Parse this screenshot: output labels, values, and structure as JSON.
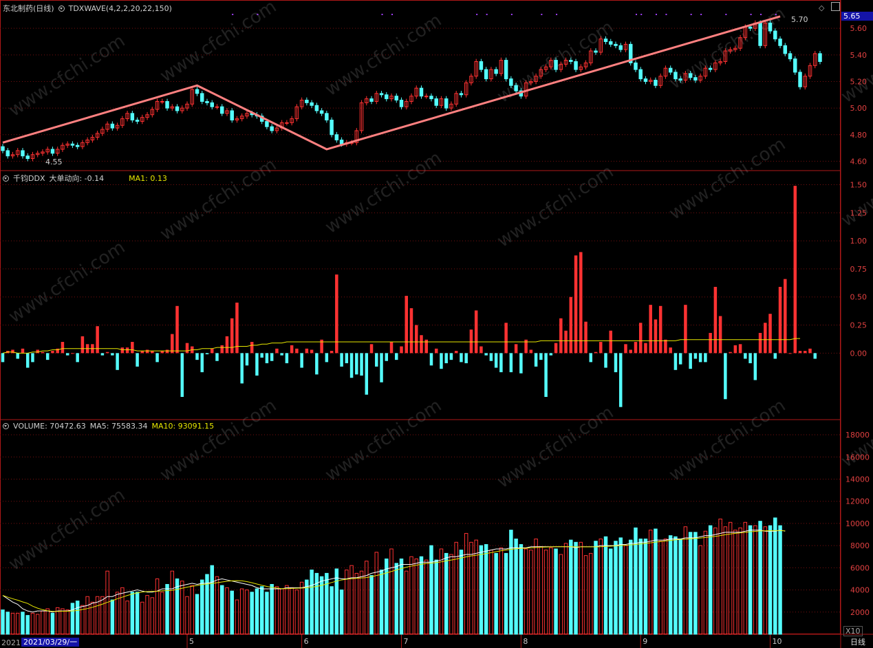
{
  "window": {
    "stock_title": "东北制药(日线)",
    "indicator_title": "TDXWAVE(4,2,2,20,22,150)",
    "price_box": "5.65",
    "period_label": "日线",
    "scale_label": "X10",
    "date_box": "2021/03/29/一",
    "year_prefix": "2021",
    "watermark": "www.cfchi.com"
  },
  "panels": {
    "price": {
      "high_label": "5.70",
      "low_label": "4.55",
      "axis_ticks": [
        "5.60",
        "5.40",
        "5.20",
        "5.00",
        "4.80",
        "4.60"
      ]
    },
    "ddx": {
      "title": "千钧DDX",
      "value_label": "大单动向: -0.14",
      "ma_label": "MA1: 0.13",
      "axis_ticks": [
        "1.50",
        "1.25",
        "1.00",
        "0.75",
        "0.50",
        "0.25",
        "0.00"
      ]
    },
    "volume": {
      "title": "VOLUME: 70472.63",
      "ma5_label": "MA5: 75583.34",
      "ma10_label": "MA10: 93091.15",
      "axis_ticks": [
        "18000",
        "16000",
        "14000",
        "12000",
        "10000",
        "8000",
        "6000",
        "4000",
        "2000"
      ]
    }
  },
  "x_axis": {
    "month_labels": [
      "5",
      "6",
      "7",
      "8",
      "9",
      "10"
    ]
  },
  "colors": {
    "up": "#ff3232",
    "down": "#54fcfc",
    "wave": "#ff8080",
    "ma_white": "#ffffff",
    "ma_yellow": "#e8e800",
    "grid": "#7a1010",
    "border": "#b01818"
  },
  "chart_data": {
    "type": "candlestick",
    "date_start": "2021/03/29",
    "price_range": [
      4.55,
      5.7
    ],
    "wave_points": [
      {
        "bar": 0,
        "price": 4.74
      },
      {
        "bar": 39,
        "price": 5.17
      },
      {
        "bar": 65,
        "price": 4.69
      },
      {
        "bar": 156,
        "price": 5.69
      }
    ],
    "price_open": [
      4.71,
      4.68,
      4.64,
      4.65,
      4.68,
      4.64,
      4.62,
      4.65,
      4.66,
      4.67,
      4.69,
      4.66,
      4.69,
      4.72,
      4.73,
      4.72,
      4.71,
      4.74,
      4.76,
      4.78,
      4.81,
      4.84,
      4.88,
      4.85,
      4.87,
      4.92,
      4.96,
      4.91,
      4.9,
      4.93,
      4.95,
      4.99,
      5.05,
      5.05,
      5.0,
      5.01,
      4.98,
      5.0,
      5.03,
      5.14,
      5.11,
      5.05,
      5.04,
      5.01,
      5.01,
      4.96,
      4.98,
      4.91,
      4.92,
      4.94,
      4.96,
      4.95,
      4.94,
      4.9,
      4.86,
      4.83,
      4.85,
      4.89,
      4.89,
      4.92,
      5.01,
      5.06,
      5.04,
      5.02,
      4.98,
      4.96,
      4.91,
      4.8,
      4.76,
      4.73,
      4.74,
      4.74,
      4.83,
      5.04,
      5.07,
      5.05,
      5.11,
      5.1,
      5.07,
      5.09,
      5.06,
      5.01,
      5.05,
      5.09,
      5.15,
      5.09,
      5.09,
      5.07,
      5.02,
      5.07,
      5.0,
      5.03,
      5.11,
      5.1,
      5.19,
      5.24,
      5.35,
      5.29,
      5.22,
      5.29,
      5.26,
      5.36,
      5.22,
      5.17,
      5.13,
      5.09,
      5.19,
      5.2,
      5.24,
      5.29,
      5.31,
      5.36,
      5.29,
      5.33,
      5.36,
      5.35,
      5.29,
      5.31,
      5.34,
      5.43,
      5.42,
      5.52,
      5.5,
      5.48,
      5.47,
      5.44,
      5.48,
      5.34,
      5.29,
      5.22,
      5.2,
      5.21,
      5.17,
      5.24,
      5.3,
      5.27,
      5.22,
      5.21,
      5.26,
      5.23,
      5.21,
      5.24,
      5.3,
      5.29,
      5.34,
      5.35,
      5.43,
      5.44,
      5.45,
      5.53,
      5.61,
      5.6,
      5.64,
      5.47,
      5.64,
      5.58,
      5.52,
      5.47,
      5.41,
      5.37,
      5.27,
      5.16,
      5.24,
      5.32,
      5.41
    ],
    "price_close": [
      4.68,
      4.64,
      4.65,
      4.68,
      4.64,
      4.62,
      4.65,
      4.66,
      4.67,
      4.69,
      4.66,
      4.69,
      4.72,
      4.73,
      4.72,
      4.71,
      4.74,
      4.76,
      4.78,
      4.81,
      4.84,
      4.88,
      4.85,
      4.87,
      4.92,
      4.96,
      4.91,
      4.9,
      4.93,
      4.95,
      4.99,
      5.05,
      5.05,
      5.0,
      5.01,
      4.98,
      5.0,
      5.03,
      5.14,
      5.11,
      5.05,
      5.04,
      5.01,
      5.01,
      4.96,
      4.98,
      4.91,
      4.92,
      4.94,
      4.96,
      4.95,
      4.94,
      4.9,
      4.86,
      4.83,
      4.85,
      4.89,
      4.89,
      4.92,
      5.01,
      5.06,
      5.04,
      5.02,
      4.98,
      4.96,
      4.91,
      4.8,
      4.76,
      4.73,
      4.74,
      4.74,
      4.83,
      5.04,
      5.07,
      5.05,
      5.11,
      5.1,
      5.07,
      5.09,
      5.06,
      5.01,
      5.05,
      5.09,
      5.15,
      5.09,
      5.09,
      5.07,
      5.02,
      5.07,
      5.0,
      5.03,
      5.11,
      5.1,
      5.19,
      5.24,
      5.35,
      5.29,
      5.22,
      5.29,
      5.26,
      5.36,
      5.22,
      5.17,
      5.13,
      5.09,
      5.19,
      5.2,
      5.24,
      5.29,
      5.31,
      5.36,
      5.29,
      5.33,
      5.36,
      5.35,
      5.29,
      5.31,
      5.34,
      5.43,
      5.42,
      5.52,
      5.5,
      5.48,
      5.47,
      5.44,
      5.48,
      5.34,
      5.29,
      5.22,
      5.2,
      5.21,
      5.17,
      5.24,
      5.3,
      5.27,
      5.22,
      5.21,
      5.26,
      5.23,
      5.21,
      5.24,
      5.3,
      5.29,
      5.34,
      5.35,
      5.43,
      5.44,
      5.45,
      5.53,
      5.61,
      5.6,
      5.64,
      5.47,
      5.64,
      5.58,
      5.52,
      5.47,
      5.41,
      5.37,
      5.27,
      5.16,
      5.24,
      5.32,
      5.41,
      5.35
    ],
    "ddx": [
      -0.08,
      0.02,
      0.03,
      -0.05,
      0.04,
      -0.13,
      -0.08,
      0.03,
      0.01,
      -0.06,
      0.02,
      0.04,
      0.1,
      -0.02,
      0.0,
      -0.08,
      0.15,
      0.08,
      0.08,
      0.24,
      -0.02,
      0.01,
      -0.02,
      -0.15,
      0.05,
      0.05,
      0.1,
      -0.12,
      0.02,
      0.03,
      0.02,
      -0.08,
      0.02,
      0.03,
      0.17,
      0.42,
      -0.39,
      0.09,
      0.06,
      -0.06,
      -0.17,
      -0.01,
      0.04,
      -0.07,
      0.07,
      0.15,
      0.31,
      0.45,
      -0.27,
      -0.11,
      0.1,
      -0.2,
      -0.04,
      -0.09,
      -0.07,
      0.04,
      -0.02,
      -0.09,
      0.07,
      0.04,
      -0.13,
      0.04,
      0.03,
      -0.19,
      0.12,
      -0.08,
      0.02,
      0.7,
      -0.12,
      -0.09,
      -0.22,
      -0.19,
      -0.2,
      -0.37,
      0.08,
      -0.12,
      -0.26,
      -0.07,
      0.1,
      -0.06,
      0.06,
      0.51,
      0.4,
      0.25,
      0.16,
      0.12,
      -0.11,
      0.04,
      -0.14,
      -0.09,
      -0.06,
      0.02,
      -0.08,
      -0.09,
      0.21,
      0.38,
      0.06,
      -0.02,
      -0.07,
      -0.13,
      -0.17,
      0.27,
      -0.17,
      0.08,
      -0.18,
      0.12,
      0.03,
      -0.12,
      -0.06,
      -0.39,
      -0.02,
      0.09,
      0.31,
      0.2,
      0.5,
      0.87,
      0.9,
      0.28,
      -0.08,
      0.01,
      0.1,
      -0.13,
      0.2,
      -0.17,
      -0.48,
      0.08,
      0.03,
      0.1,
      0.27,
      0.09,
      0.43,
      0.3,
      0.42,
      0.12,
      0.05,
      -0.15,
      -0.1,
      0.43,
      -0.14,
      -0.05,
      -0.08,
      -0.08,
      0.18,
      0.59,
      0.33,
      -0.41,
      0.01,
      0.07,
      0.08,
      -0.05,
      -0.09,
      -0.24,
      0.18,
      0.27,
      0.35,
      -0.05,
      0.59,
      0.66,
      0.0,
      1.49,
      0.02,
      0.02,
      0.04,
      -0.05
    ],
    "ddx_ma": [
      0.0,
      0.01,
      0.01,
      0.0,
      0.0,
      -0.0,
      0.01,
      0.01,
      0.02,
      0.02,
      0.03,
      0.03,
      0.04,
      0.04,
      0.04,
      0.04,
      0.04,
      0.04,
      0.04,
      0.04,
      0.04,
      0.04,
      0.04,
      0.04,
      0.03,
      0.03,
      0.03,
      0.02,
      0.02,
      0.02,
      0.02,
      0.02,
      0.02,
      0.02,
      0.02,
      0.02,
      0.02,
      0.02,
      0.03,
      0.03,
      0.04,
      0.04,
      0.04,
      0.05,
      0.05,
      0.05,
      0.05,
      0.06,
      0.06,
      0.06,
      0.07,
      0.07,
      0.08,
      0.08,
      0.09,
      0.09,
      0.09,
      0.1,
      0.1,
      0.1,
      0.1,
      0.1,
      0.1,
      0.1,
      0.1,
      0.1,
      0.1,
      0.1,
      0.1,
      0.1,
      0.1,
      0.1,
      0.1,
      0.1,
      0.1,
      0.1,
      0.1,
      0.1,
      0.1,
      0.1,
      0.1,
      0.1,
      0.1,
      0.1,
      0.1,
      0.1,
      0.1,
      0.1,
      0.1,
      0.1,
      0.1,
      0.1,
      0.1,
      0.1,
      0.1,
      0.1,
      0.1,
      0.1,
      0.1,
      0.1,
      0.1,
      0.1,
      0.1,
      0.1,
      0.1,
      0.1,
      0.1,
      0.1,
      0.11,
      0.11,
      0.11,
      0.11,
      0.11,
      0.11,
      0.11,
      0.11,
      0.11,
      0.11,
      0.11,
      0.11,
      0.11,
      0.11,
      0.11,
      0.11,
      0.11,
      0.11,
      0.11,
      0.11,
      0.11,
      0.11,
      0.11,
      0.11,
      0.11,
      0.11,
      0.11,
      0.11,
      0.12,
      0.12,
      0.12,
      0.12,
      0.12,
      0.12,
      0.12,
      0.12,
      0.12,
      0.12,
      0.12,
      0.12,
      0.12,
      0.12,
      0.12,
      0.12,
      0.12,
      0.12,
      0.12,
      0.12,
      0.12,
      0.12,
      0.12,
      0.13,
      0.13
    ],
    "volume": [
      2200,
      2000,
      1900,
      1900,
      2000,
      1700,
      1900,
      1800,
      2100,
      2300,
      1900,
      2400,
      2300,
      2200,
      2800,
      3000,
      2600,
      3400,
      2900,
      3400,
      3400,
      5700,
      3100,
      3800,
      4200,
      3000,
      3800,
      3800,
      2900,
      3500,
      3300,
      5000,
      3800,
      4500,
      5700,
      5000,
      4800,
      3400,
      4400,
      3600,
      4900,
      5400,
      6200,
      5200,
      4400,
      4200,
      3900,
      3100,
      4100,
      4000,
      3800,
      4100,
      4300,
      3800,
      4500,
      4300,
      4100,
      4400,
      4200,
      4000,
      4700,
      4900,
      5800,
      5500,
      5200,
      5500,
      4300,
      5900,
      4000,
      5800,
      6200,
      5500,
      5700,
      6600,
      5300,
      7400,
      5800,
      6800,
      7700,
      6400,
      6800,
      5700,
      7000,
      6800,
      7000,
      6700,
      8000,
      6700,
      7700,
      7300,
      7200,
      8300,
      7600,
      9100,
      8300,
      8500,
      8000,
      8100,
      7600,
      7300,
      7800,
      7300,
      9400,
      8600,
      8100,
      7700,
      7600,
      8600,
      7900,
      7600,
      7800,
      7700,
      7200,
      8200,
      8500,
      8300,
      8300,
      7100,
      7300,
      8400,
      8600,
      8800,
      7700,
      8400,
      8700,
      8000,
      8500,
      9600,
      8600,
      8600,
      9400,
      9500,
      8400,
      8600,
      8900,
      8800,
      8600,
      9700,
      9200,
      9200,
      8000,
      9300,
      9800,
      9600,
      10400,
      9700,
      10100,
      9400,
      9600,
      10100,
      9800,
      9800,
      10200,
      9700,
      9800,
      10500,
      9800
    ],
    "volume_ma5": [
      3500,
      3200,
      2900,
      2700,
      2300,
      2100,
      2000,
      2100,
      2100,
      2100,
      2000,
      2100,
      2100,
      2100,
      2200,
      2400,
      2500,
      2600,
      2800,
      2900,
      3100,
      3400,
      3400,
      3600,
      3700,
      3800,
      3900,
      4000,
      3900,
      3800,
      3800,
      3900,
      4100,
      4100,
      4100,
      4300,
      4400,
      4500,
      4600,
      4500,
      4600,
      4600,
      4700,
      4900,
      5000,
      4900,
      4800,
      4700,
      4600,
      4500,
      4400,
      4200,
      4100,
      4100,
      4100,
      4100,
      4100,
      4200,
      4200,
      4200,
      4200,
      4300,
      4400,
      4600,
      4800,
      4900,
      5000,
      5100,
      5000,
      5000,
      5100,
      5100,
      5200,
      5300,
      5500,
      5600,
      5700,
      5900,
      6000,
      6100,
      6300,
      6300,
      6300,
      6400,
      6500,
      6500,
      6500,
      6600,
      6700,
      6900,
      7000,
      7000,
      7100,
      7200,
      7200,
      7300,
      7400,
      7500,
      7600,
      7700,
      7700,
      7700,
      7800,
      7800,
      7800,
      7800,
      7900,
      7900,
      7900,
      7900,
      7900,
      7900,
      7900,
      7900,
      7900,
      7800,
      7900,
      7900,
      7900,
      7900,
      8000,
      8000,
      8000,
      8000,
      8100,
      8100,
      8200,
      8200,
      8300,
      8300,
      8400,
      8500,
      8500,
      8500,
      8600,
      8600,
      8600,
      8700,
      8700,
      8700,
      8800,
      8900,
      8900,
      9000,
      9100,
      9200,
      9200,
      9200,
      9200,
      9300,
      9400,
      9400,
      9400,
      9300,
      9300,
      9300,
      9400,
      9300
    ]
  }
}
